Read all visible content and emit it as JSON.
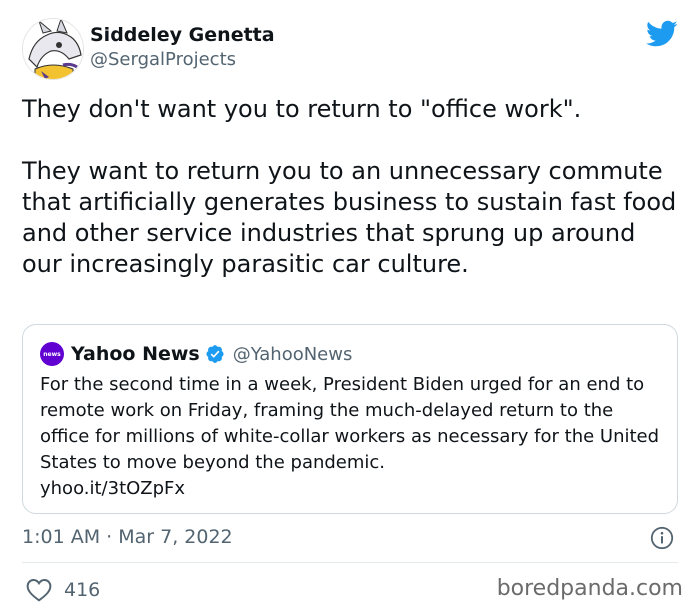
{
  "author": {
    "display_name": "Siddeley Genetta",
    "handle": "@SergalProjects"
  },
  "tweet": {
    "paragraph_1": "They don't want you to return to \"office work\".",
    "paragraph_2": "They want to return you to an unnecessary commute that artificially generates business to sustain fast food and other service industries that sprung up around our increasingly parasitic car culture."
  },
  "quoted_tweet": {
    "avatar_text": "news",
    "display_name": "Yahoo News",
    "handle": "@YahooNews",
    "text": "For the second time in a week, President Biden urged for an end to remote work on Friday, framing the much-delayed return to the office for millions of white-collar workers as necessary for the United States to move beyond the pandemic.",
    "link": "yhoo.it/3tOZpFx"
  },
  "meta": {
    "timestamp": "1:01 AM · Mar 7, 2022"
  },
  "engagement": {
    "likes": "416"
  },
  "watermark": "boredpanda.com",
  "icons": {
    "brand": "twitter-bird-icon",
    "verified": "verified-badge-icon",
    "info": "info-icon",
    "like": "heart-icon"
  },
  "colors": {
    "twitter_blue": "#1d9bf0",
    "yahoo_purple": "#6001d2",
    "secondary_text": "#536471"
  }
}
